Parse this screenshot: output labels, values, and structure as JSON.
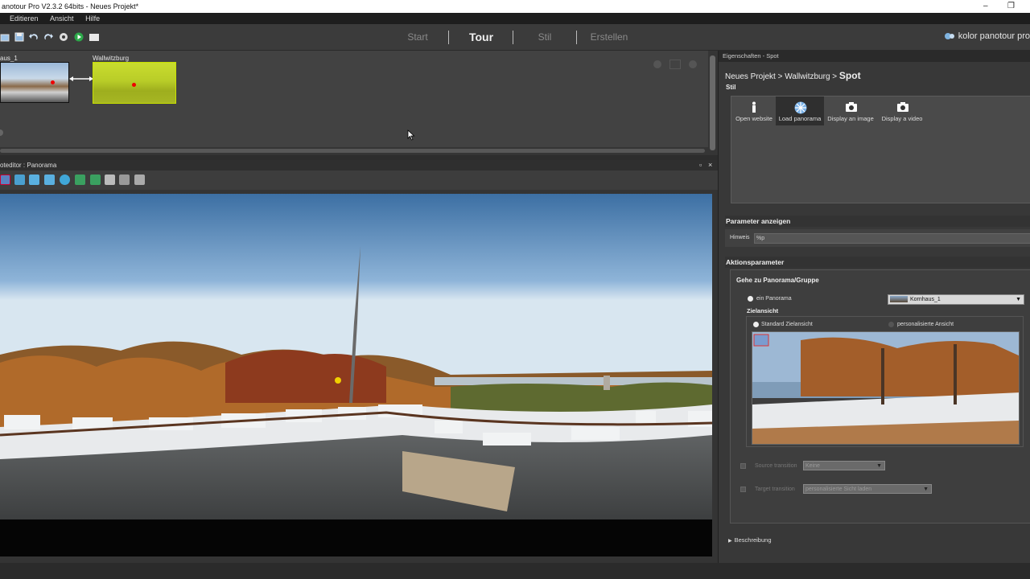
{
  "window": {
    "title": "anotour Pro V2.3.2 64bits - Neues Projekt*",
    "minimize_glyph": "–",
    "restore_glyph": "❐"
  },
  "menu": {
    "items": [
      "Editieren",
      "Ansicht",
      "Hilfe"
    ]
  },
  "workflow": {
    "steps": [
      "Start",
      "Tour",
      "Stil",
      "Erstellen"
    ],
    "active": "Tour"
  },
  "brand": {
    "text": "kolor panotour pro"
  },
  "tour": {
    "panoramas": [
      {
        "label": "aus_1"
      },
      {
        "label": "Wallwitzburg"
      }
    ]
  },
  "editor": {
    "title": "oteditor : Panorama",
    "head_icons": [
      "float-icon",
      "close-icon"
    ]
  },
  "properties": {
    "header": "Eigenschaften - Spot",
    "breadcrumb_prefix": "Neues Projekt > Wallwitzburg > ",
    "breadcrumb_current": "Spot",
    "stil_label": "Stil",
    "stil_options": [
      {
        "label": "Open website",
        "icon": "info-icon"
      },
      {
        "label": "Load panorama",
        "icon": "panorama-icon"
      },
      {
        "label": "Display an image",
        "icon": "camera-icon"
      },
      {
        "label": "Display a video",
        "icon": "video-camera-icon"
      }
    ],
    "selected_stil": "Load panorama",
    "parameter_anzeigen": "Parameter anzeigen",
    "hinweis_label": "Hinweis",
    "hinweis_value": "%p",
    "aktionsparameter": "Aktionsparameter",
    "gehe_zu": "Gehe zu Panorama/Gruppe",
    "ein_panorama": "ein Panorama",
    "panorama_select": "Kornhaus_1",
    "zielansicht": "Zielansicht",
    "standard_zielansicht": "Standard Zielansicht",
    "personalisierte_ansicht": "personalisierte Ansicht",
    "source_transition_label": "Source transition",
    "source_transition_value": "Keine",
    "target_transition_label": "Target transition",
    "target_transition_value": "personalisierte Sicht laden",
    "beschreibung": "Beschreibung"
  },
  "colors": {
    "accent_thumb_border": "#c8e000",
    "selected_stil_bg": "#2f2f2f"
  }
}
